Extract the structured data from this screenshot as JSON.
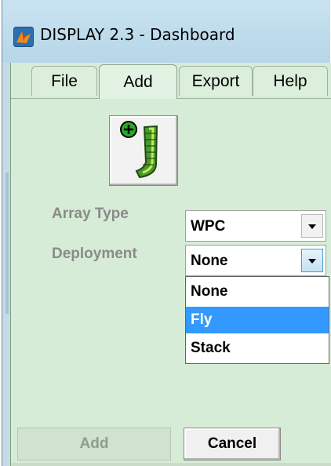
{
  "window": {
    "title": "DISPLAY 2.3 - Dashboard",
    "icon": "matlab-icon"
  },
  "menu_tabs": [
    {
      "label": "File",
      "active": false
    },
    {
      "label": "Add",
      "active": true
    },
    {
      "label": "Export",
      "active": false
    },
    {
      "label": "Help",
      "active": false
    }
  ],
  "toolbar": {
    "array_button_icon": "add-array-icon"
  },
  "form": {
    "array_type": {
      "label": "Array Type",
      "value": "WPC"
    },
    "deployment": {
      "label": "Deployment",
      "value": "None"
    }
  },
  "deployment_dropdown": {
    "options": [
      "None",
      "Fly",
      "Stack"
    ],
    "highlighted": "Fly"
  },
  "buttons": {
    "add": {
      "label": "Add",
      "enabled": false
    },
    "cancel": {
      "label": "Cancel",
      "enabled": true
    }
  },
  "colors": {
    "panel_bg": "#d6ecd6",
    "selection": "#3399ff",
    "disabled_text": "#8c9f8c"
  }
}
